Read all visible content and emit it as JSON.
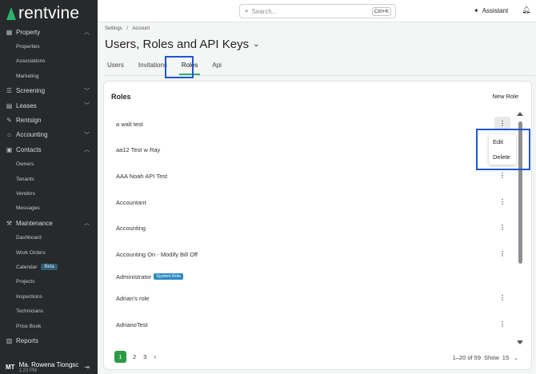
{
  "app": {
    "logo_text": "rentvine"
  },
  "search": {
    "placeholder": "Search...",
    "shortcut": "Ctrl+K"
  },
  "topbar": {
    "assistant_label": "Assistant"
  },
  "sidebar": {
    "sections": [
      {
        "label": "Property",
        "icon": "building-icon",
        "expanded": true
      },
      {
        "label": "Screening",
        "icon": "screening-icon",
        "expanded": false
      },
      {
        "label": "Leases",
        "icon": "lease-icon",
        "expanded": false
      },
      {
        "label": "Rentsign",
        "icon": "sign-icon"
      },
      {
        "label": "Accounting",
        "icon": "bank-icon",
        "expanded": false
      },
      {
        "label": "Contacts",
        "icon": "contacts-icon",
        "expanded": true
      },
      {
        "label": "Maintenance",
        "icon": "wrench-icon",
        "expanded": true
      },
      {
        "label": "Reports",
        "icon": "chart-icon"
      }
    ],
    "property_items": [
      "Properties",
      "Associations",
      "Marketing"
    ],
    "contacts_items": [
      "Owners",
      "Tenants",
      "Vendors",
      "Messages"
    ],
    "maintenance_items": [
      "Dashboard",
      "Work Orders",
      "Calendar",
      "Projects",
      "Inspections",
      "Technicians",
      "Price Book"
    ],
    "calendar_badge": "Beta",
    "user": {
      "initials": "MT",
      "name": "Ma. Rowena Tiongsc",
      "time": "1:23 PM"
    }
  },
  "breadcrumb": {
    "level1": "Settings",
    "separator": "/",
    "level2": "Account"
  },
  "page": {
    "title": "Users, Roles and API Keys"
  },
  "tabs": [
    "Users",
    "Invitations",
    "Roles",
    "Api"
  ],
  "active_tab": "Roles",
  "roles_card": {
    "title": "Roles",
    "new_role_label": "New Role",
    "rows": [
      {
        "name": "a walt test"
      },
      {
        "name": "aa12 Test w Ray"
      },
      {
        "name": "AAA Noah API Test"
      },
      {
        "name": "Accountant"
      },
      {
        "name": "Accounting"
      },
      {
        "name": "Accounting On - Modify Bill Off"
      },
      {
        "name": "Administrator",
        "badge": "System Role"
      },
      {
        "name": "Adrian's role"
      },
      {
        "name": "AdrianoTest"
      }
    ],
    "context_menu": [
      "Edit",
      "Delete"
    ]
  },
  "pagination": {
    "pages": [
      "1",
      "2",
      "3"
    ],
    "current": "1",
    "range_text": "1–20 of 59",
    "show_label": "Show",
    "page_size": "15"
  },
  "colors": {
    "accent": "#2bb36b",
    "highlight_box": "#1e54d6",
    "sidebar_bg": "#27292b",
    "system_badge": "#2d8ac0"
  }
}
